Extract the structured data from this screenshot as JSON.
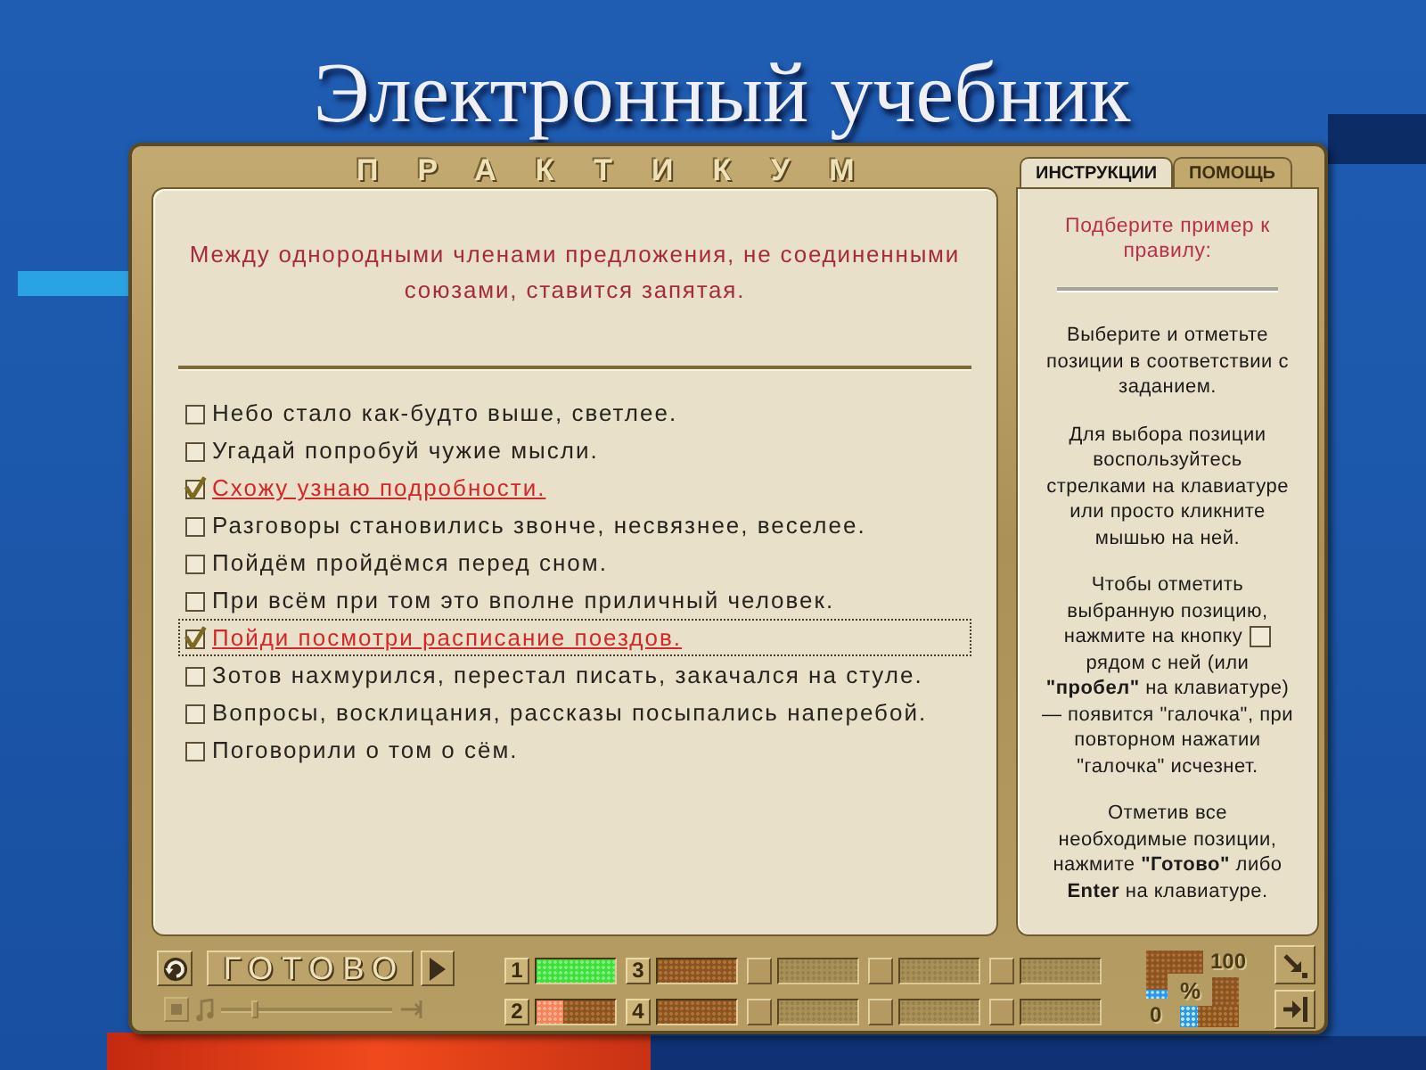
{
  "slide": {
    "title": "Электронный учебник"
  },
  "app": {
    "header": "ПРАКТИКУМ",
    "tabs": [
      {
        "label": "ИНСТРУКЦИИ",
        "selected": true
      },
      {
        "label": "ПОМОЩЬ",
        "selected": false
      }
    ]
  },
  "task": {
    "rule": "Между однородными членами предложения, не соединенными союзами, ставится запятая.",
    "options": [
      {
        "text": "Небо стало как-будто выше, светлее.",
        "checked": false,
        "focused": false
      },
      {
        "text": "Угадай попробуй чужие мысли.",
        "checked": false,
        "focused": false
      },
      {
        "text": "Схожу узнаю подробности.",
        "checked": true,
        "focused": false
      },
      {
        "text": "Разговоры становились звонче, несвязнее, веселее.",
        "checked": false,
        "focused": false
      },
      {
        "text": "Пойдём пройдёмся перед сном.",
        "checked": false,
        "focused": false
      },
      {
        "text": "При всём при том это вполне приличный человек.",
        "checked": false,
        "focused": false
      },
      {
        "text": "Пойди посмотри расписание поездов.",
        "checked": true,
        "focused": true
      },
      {
        "text": "Зотов нахмурился, перестал писать, закачался на стуле.",
        "checked": false,
        "focused": false
      },
      {
        "text": "Вопросы, восклицания, рассказы посыпались наперебой.",
        "checked": false,
        "focused": false
      },
      {
        "text": "Поговорили о том о сём.",
        "checked": false,
        "focused": false
      }
    ]
  },
  "instructions": {
    "heading": "Подберите пример к правилу:",
    "paragraphs": [
      {
        "kind": "text",
        "text": "Выберите и отметьте позиции в соответствии с заданием."
      },
      {
        "kind": "text",
        "text": "Для выбора позиции воспользуйтесь стрелками на клавиатуре или просто кликните мышью на ней."
      },
      {
        "kind": "checkbox_hint",
        "before": "Чтобы отметить выбранную позицию,",
        "button_line": "нажмите на кнопку",
        "after": "рядом с ней (или **\"пробел\"** на клавиатуре) — появится \"галочка\", при повторном нажатии \"галочка\" исчезнет."
      },
      {
        "kind": "text",
        "text": "Отметив все необходимые позиции, нажмите **\"Готово\"** либо **Enter** на клавиатуре."
      }
    ]
  },
  "toolbar": {
    "done_button": "ГОТОВО",
    "player": {
      "disabled": true,
      "level": 0.2
    },
    "counters": [
      {
        "label": "1",
        "level": 1,
        "color": "#3ee03a"
      },
      {
        "label": "2",
        "level": 0.35,
        "color": "#f4845a"
      },
      {
        "label": "3"
      },
      {
        "label": "4"
      }
    ],
    "score": {
      "max": "100",
      "sign": "%",
      "min": "0",
      "level": 0.3
    }
  }
}
